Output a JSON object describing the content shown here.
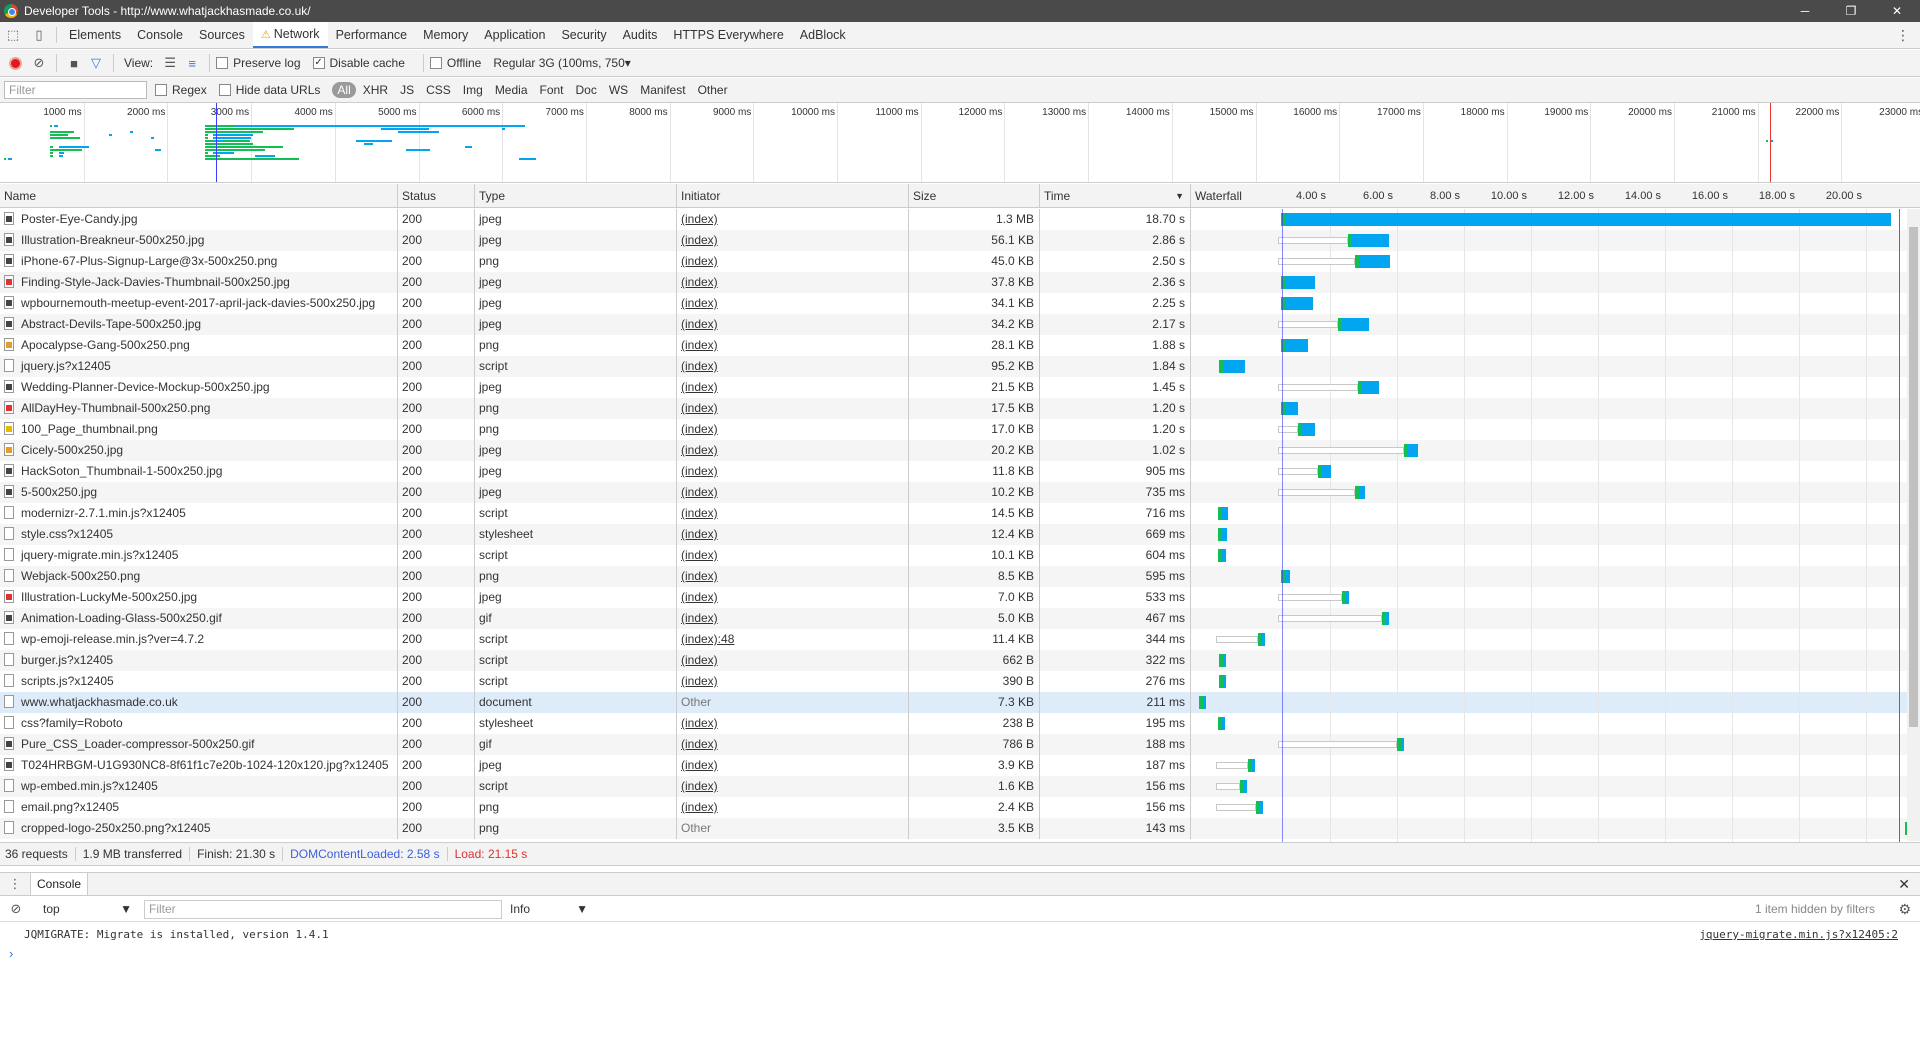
{
  "window": {
    "title": "Developer Tools - http://www.whatjackhasmade.co.uk/",
    "minimize": "─",
    "maximize": "❐",
    "close": "✕"
  },
  "panel_tabs": [
    {
      "label": "Elements",
      "active": false
    },
    {
      "label": "Console",
      "active": false
    },
    {
      "label": "Sources",
      "active": false
    },
    {
      "label": "Network",
      "active": true
    },
    {
      "label": "Performance",
      "active": false
    },
    {
      "label": "Memory",
      "active": false
    },
    {
      "label": "Application",
      "active": false
    },
    {
      "label": "Security",
      "active": false
    },
    {
      "label": "Audits",
      "active": false
    },
    {
      "label": "HTTPS Everywhere",
      "active": false
    },
    {
      "label": "AdBlock",
      "active": false
    }
  ],
  "toolbar": {
    "view_label": "View:",
    "preserve_log": "Preserve log",
    "disable_cache": "Disable cache",
    "offline": "Offline",
    "throttle": "Regular 3G (100ms, 750",
    "preserve_log_checked": false,
    "disable_cache_checked": true,
    "offline_checked": false
  },
  "filterbar": {
    "placeholder": "Filter",
    "regex": "Regex",
    "hide_data_urls": "Hide data URLs",
    "types": [
      "All",
      "XHR",
      "JS",
      "CSS",
      "Img",
      "Media",
      "Font",
      "Doc",
      "WS",
      "Manifest",
      "Other"
    ],
    "active_type": "All"
  },
  "overview_ticks": [
    "1000 ms",
    "2000 ms",
    "3000 ms",
    "4000 ms",
    "5000 ms",
    "6000 ms",
    "7000 ms",
    "8000 ms",
    "9000 ms",
    "10000 ms",
    "11000 ms",
    "12000 ms",
    "13000 ms",
    "14000 ms",
    "15000 ms",
    "16000 ms",
    "17000 ms",
    "18000 ms",
    "19000 ms",
    "20000 ms",
    "21000 ms",
    "22000 ms",
    "23000 ms"
  ],
  "columns": {
    "name": "Name",
    "status": "Status",
    "type": "Type",
    "initiator": "Initiator",
    "size": "Size",
    "time": "Time",
    "waterfall": "Waterfall"
  },
  "waterfall_ticks": [
    "4.00 s",
    "6.00 s",
    "8.00 s",
    "10.00 s",
    "12.00 s",
    "14.00 s",
    "16.00 s",
    "18.00 s",
    "20.00 s"
  ],
  "requests": [
    {
      "name": "Poster-Eye-Candy.jpg",
      "status": "200",
      "type": "jpeg",
      "initiator": "(index)",
      "size": "1.3 MB",
      "time": "18.70 s",
      "icon": "img",
      "start_s": 2.45,
      "ttfb_s": 0.08,
      "duration_s": 18.7
    },
    {
      "name": "Illustration-Breakneur-500x250.jpg",
      "status": "200",
      "type": "jpeg",
      "initiator": "(index)",
      "size": "56.1 KB",
      "time": "2.86 s",
      "icon": "img",
      "start_s": 2.45,
      "ttfb_s": 2.1,
      "duration_s": 2.86
    },
    {
      "name": "iPhone-67-Plus-Signup-Large@3x-500x250.png",
      "status": "200",
      "type": "png",
      "initiator": "(index)",
      "size": "45.0 KB",
      "time": "2.50 s",
      "icon": "img",
      "start_s": 2.45,
      "ttfb_s": 2.3,
      "duration_s": 2.5
    },
    {
      "name": "Finding-Style-Jack-Davies-Thumbnail-500x250.jpg",
      "status": "200",
      "type": "jpeg",
      "initiator": "(index)",
      "size": "37.8 KB",
      "time": "2.36 s",
      "icon": "red",
      "start_s": 2.45,
      "ttfb_s": 0.1,
      "duration_s": 2.36
    },
    {
      "name": "wpbournemouth-meetup-event-2017-april-jack-davies-500x250.jpg",
      "status": "200",
      "type": "jpeg",
      "initiator": "(index)",
      "size": "34.1 KB",
      "time": "2.25 s",
      "icon": "img",
      "start_s": 2.45,
      "ttfb_s": 0.1,
      "duration_s": 2.25
    },
    {
      "name": "Abstract-Devils-Tape-500x250.jpg",
      "status": "200",
      "type": "jpeg",
      "initiator": "(index)",
      "size": "34.2 KB",
      "time": "2.17 s",
      "icon": "img",
      "start_s": 2.45,
      "ttfb_s": 1.8,
      "duration_s": 2.17
    },
    {
      "name": "Apocalypse-Gang-500x250.png",
      "status": "200",
      "type": "png",
      "initiator": "(index)",
      "size": "28.1 KB",
      "time": "1.88 s",
      "icon": "orange",
      "start_s": 2.45,
      "ttfb_s": 0.1,
      "duration_s": 1.88
    },
    {
      "name": "jquery.js?x12405",
      "status": "200",
      "type": "script",
      "initiator": "(index)",
      "size": "95.2 KB",
      "time": "1.84 s",
      "icon": "doc",
      "start_s": 0.6,
      "ttfb_s": 0.1,
      "duration_s": 1.84
    },
    {
      "name": "Wedding-Planner-Device-Mockup-500x250.jpg",
      "status": "200",
      "type": "jpeg",
      "initiator": "(index)",
      "size": "21.5 KB",
      "time": "1.45 s",
      "icon": "img",
      "start_s": 2.45,
      "ttfb_s": 2.4,
      "duration_s": 1.45
    },
    {
      "name": "AllDayHey-Thumbnail-500x250.png",
      "status": "200",
      "type": "png",
      "initiator": "(index)",
      "size": "17.5 KB",
      "time": "1.20 s",
      "icon": "red",
      "start_s": 2.45,
      "ttfb_s": 0.1,
      "duration_s": 1.2
    },
    {
      "name": "100_Page_thumbnail.png",
      "status": "200",
      "type": "png",
      "initiator": "(index)",
      "size": "17.0 KB",
      "time": "1.20 s",
      "icon": "yellow",
      "start_s": 2.45,
      "ttfb_s": 0.6,
      "duration_s": 1.2
    },
    {
      "name": "Cicely-500x250.jpg",
      "status": "200",
      "type": "jpeg",
      "initiator": "(index)",
      "size": "20.2 KB",
      "time": "1.02 s",
      "icon": "orange",
      "start_s": 2.45,
      "ttfb_s": 3.75,
      "duration_s": 1.02
    },
    {
      "name": "HackSoton_Thumbnail-1-500x250.jpg",
      "status": "200",
      "type": "jpeg",
      "initiator": "(index)",
      "size": "11.8 KB",
      "time": "905 ms",
      "icon": "img",
      "start_s": 2.45,
      "ttfb_s": 1.2,
      "duration_s": 0.905
    },
    {
      "name": "5-500x250.jpg",
      "status": "200",
      "type": "jpeg",
      "initiator": "(index)",
      "size": "10.2 KB",
      "time": "735 ms",
      "icon": "img",
      "start_s": 2.45,
      "ttfb_s": 2.3,
      "duration_s": 0.735
    },
    {
      "name": "modernizr-2.7.1.min.js?x12405",
      "status": "200",
      "type": "script",
      "initiator": "(index)",
      "size": "14.5 KB",
      "time": "716 ms",
      "icon": "doc",
      "start_s": 0.6,
      "ttfb_s": 0.05,
      "duration_s": 0.716
    },
    {
      "name": "style.css?x12405",
      "status": "200",
      "type": "stylesheet",
      "initiator": "(index)",
      "size": "12.4 KB",
      "time": "669 ms",
      "icon": "doc",
      "start_s": 0.6,
      "ttfb_s": 0.05,
      "duration_s": 0.669
    },
    {
      "name": "jquery-migrate.min.js?x12405",
      "status": "200",
      "type": "script",
      "initiator": "(index)",
      "size": "10.1 KB",
      "time": "604 ms",
      "icon": "doc",
      "start_s": 0.6,
      "ttfb_s": 0.05,
      "duration_s": 0.604
    },
    {
      "name": "Webjack-500x250.png",
      "status": "200",
      "type": "png",
      "initiator": "(index)",
      "size": "8.5 KB",
      "time": "595 ms",
      "icon": "doc",
      "start_s": 2.45,
      "ttfb_s": 0.1,
      "duration_s": 0.595
    },
    {
      "name": "Illustration-LuckyMe-500x250.jpg",
      "status": "200",
      "type": "jpeg",
      "initiator": "(index)",
      "size": "7.0 KB",
      "time": "533 ms",
      "icon": "red",
      "start_s": 2.45,
      "ttfb_s": 1.9,
      "duration_s": 0.533
    },
    {
      "name": "Animation-Loading-Glass-500x250.gif",
      "status": "200",
      "type": "gif",
      "initiator": "(index)",
      "size": "5.0 KB",
      "time": "467 ms",
      "icon": "img",
      "start_s": 2.45,
      "ttfb_s": 3.1,
      "duration_s": 0.467
    },
    {
      "name": "wp-emoji-release.min.js?ver=4.7.2",
      "status": "200",
      "type": "script",
      "initiator": "(index):48",
      "size": "11.4 KB",
      "time": "344 ms",
      "icon": "doc",
      "start_s": 0.6,
      "ttfb_s": 1.25,
      "duration_s": 0.344
    },
    {
      "name": "burger.js?x12405",
      "status": "200",
      "type": "script",
      "initiator": "(index)",
      "size": "662 B",
      "time": "322 ms",
      "icon": "doc",
      "start_s": 0.6,
      "ttfb_s": 0.1,
      "duration_s": 0.322
    },
    {
      "name": "scripts.js?x12405",
      "status": "200",
      "type": "script",
      "initiator": "(index)",
      "size": "390 B",
      "time": "276 ms",
      "icon": "doc",
      "start_s": 0.6,
      "ttfb_s": 0.1,
      "duration_s": 0.276
    },
    {
      "name": "www.whatjackhasmade.co.uk",
      "status": "200",
      "type": "document",
      "initiator": "Other",
      "size": "7.3 KB",
      "time": "211 ms",
      "icon": "doc",
      "start_s": 0.05,
      "ttfb_s": 0.05,
      "duration_s": 0.211,
      "selected": true
    },
    {
      "name": "css?family=Roboto",
      "status": "200",
      "type": "stylesheet",
      "initiator": "(index)",
      "size": "238 B",
      "time": "195 ms",
      "icon": "doc",
      "start_s": 0.6,
      "ttfb_s": 0.05,
      "duration_s": 0.195
    },
    {
      "name": "Pure_CSS_Loader-compressor-500x250.gif",
      "status": "200",
      "type": "gif",
      "initiator": "(index)",
      "size": "786 B",
      "time": "188 ms",
      "icon": "img",
      "start_s": 2.45,
      "ttfb_s": 3.55,
      "duration_s": 0.188
    },
    {
      "name": "T024HRBGM-U1G930NC8-8f61f1c7e20b-1024-120x120.jpg?x12405",
      "status": "200",
      "type": "jpeg",
      "initiator": "(index)",
      "size": "3.9 KB",
      "time": "187 ms",
      "icon": "img",
      "start_s": 0.6,
      "ttfb_s": 0.95,
      "duration_s": 0.187
    },
    {
      "name": "wp-embed.min.js?x12405",
      "status": "200",
      "type": "script",
      "initiator": "(index)",
      "size": "1.6 KB",
      "time": "156 ms",
      "icon": "doc",
      "start_s": 0.6,
      "ttfb_s": 0.7,
      "duration_s": 0.156
    },
    {
      "name": "email.png?x12405",
      "status": "200",
      "type": "png",
      "initiator": "(index)",
      "size": "2.4 KB",
      "time": "156 ms",
      "icon": "doc",
      "start_s": 0.6,
      "ttfb_s": 1.2,
      "duration_s": 0.156
    },
    {
      "name": "cropped-logo-250x250.png?x12405",
      "status": "200",
      "type": "png",
      "initiator": "Other",
      "size": "3.5 KB",
      "time": "143 ms",
      "icon": "doc",
      "start_s": 21.1,
      "ttfb_s": 0.05,
      "duration_s": 0.143
    }
  ],
  "waterfall_markers": {
    "dom_content_loaded_s": 2.58,
    "load_s": 21.15
  },
  "summary": {
    "requests": "36 requests",
    "transferred": "1.9 MB transferred",
    "finish": "Finish: 21.30 s",
    "dcl": "DOMContentLoaded: 2.58 s",
    "load": "Load: 21.15 s"
  },
  "drawer": {
    "tab": "Console",
    "context": "top",
    "filter_placeholder": "Filter",
    "level": "Info",
    "hidden": "1 item hidden by filters",
    "message": "JQMIGRATE: Migrate is installed, version 1.4.1",
    "message_source": "jquery-migrate.min.js?x12405:2",
    "prompt": "›"
  },
  "colors": {
    "ttfb": "#13bf55",
    "download": "#02a6f0",
    "accent": "#3879d9"
  }
}
